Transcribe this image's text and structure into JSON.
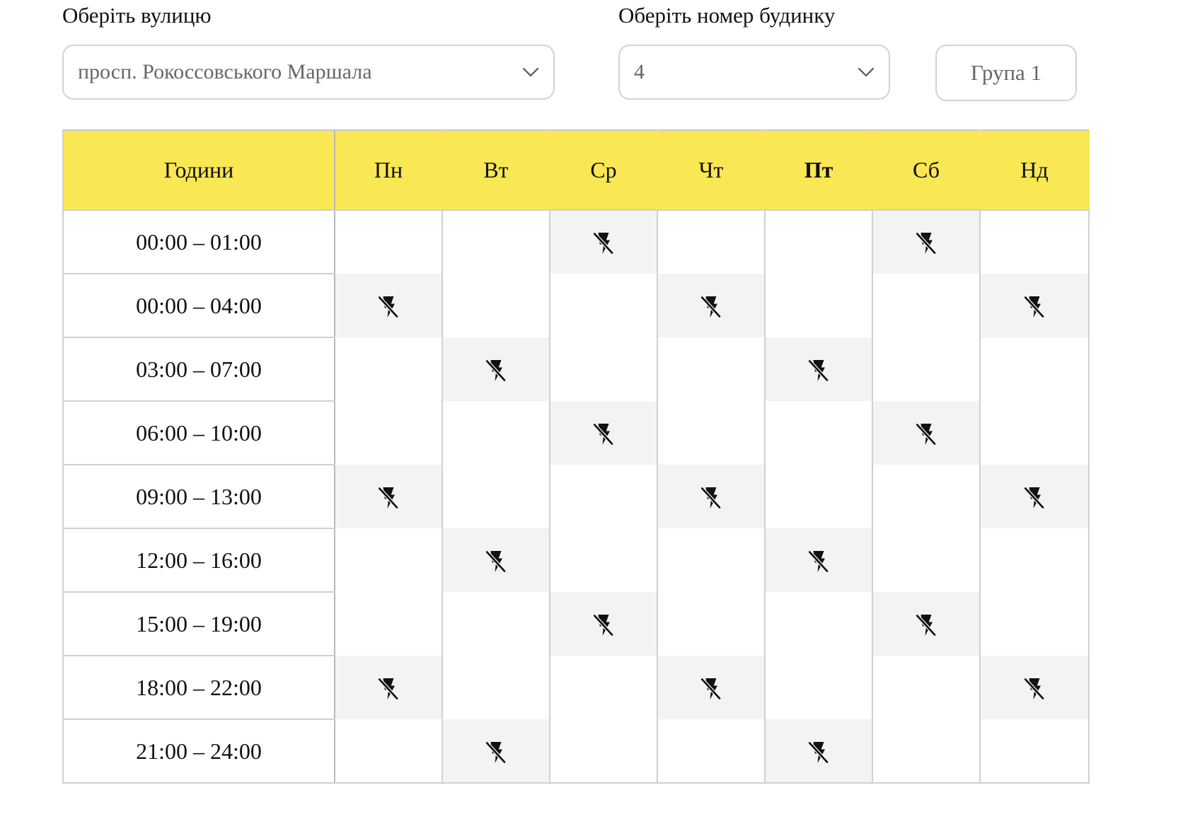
{
  "street": {
    "label": "Оберіть вулицю",
    "selected": "просп. Рокоссовського Маршала"
  },
  "house": {
    "label": "Оберіть номер будинку",
    "selected": "4"
  },
  "group_button": "Група 1",
  "table": {
    "hours_header": "Години",
    "days": [
      "Пн",
      "Вт",
      "Ср",
      "Чт",
      "Пт",
      "Сб",
      "Нд"
    ],
    "current_day_index": 4,
    "rows": [
      {
        "time": "00:00 – 01:00",
        "off": [
          false,
          false,
          true,
          false,
          false,
          true,
          false
        ]
      },
      {
        "time": "00:00 – 04:00",
        "off": [
          true,
          false,
          false,
          true,
          false,
          false,
          true
        ]
      },
      {
        "time": "03:00 – 07:00",
        "off": [
          false,
          true,
          false,
          false,
          true,
          false,
          false
        ]
      },
      {
        "time": "06:00 – 10:00",
        "off": [
          false,
          false,
          true,
          false,
          false,
          true,
          false
        ]
      },
      {
        "time": "09:00 – 13:00",
        "off": [
          true,
          false,
          false,
          true,
          false,
          false,
          true
        ]
      },
      {
        "time": "12:00 – 16:00",
        "off": [
          false,
          true,
          false,
          false,
          true,
          false,
          false
        ]
      },
      {
        "time": "15:00 – 19:00",
        "off": [
          false,
          false,
          true,
          false,
          false,
          true,
          false
        ]
      },
      {
        "time": "18:00 – 22:00",
        "off": [
          true,
          false,
          false,
          true,
          false,
          false,
          true
        ]
      },
      {
        "time": "21:00 – 24:00",
        "off": [
          false,
          true,
          false,
          false,
          true,
          false,
          false
        ]
      }
    ]
  },
  "icons": {
    "outage": "power-off-lightning-icon",
    "dropdown": "chevron-down-icon"
  },
  "colors": {
    "header_bg": "#fae754",
    "off_cell_bg": "#f3f3f3",
    "border": "#d0d0d0"
  }
}
